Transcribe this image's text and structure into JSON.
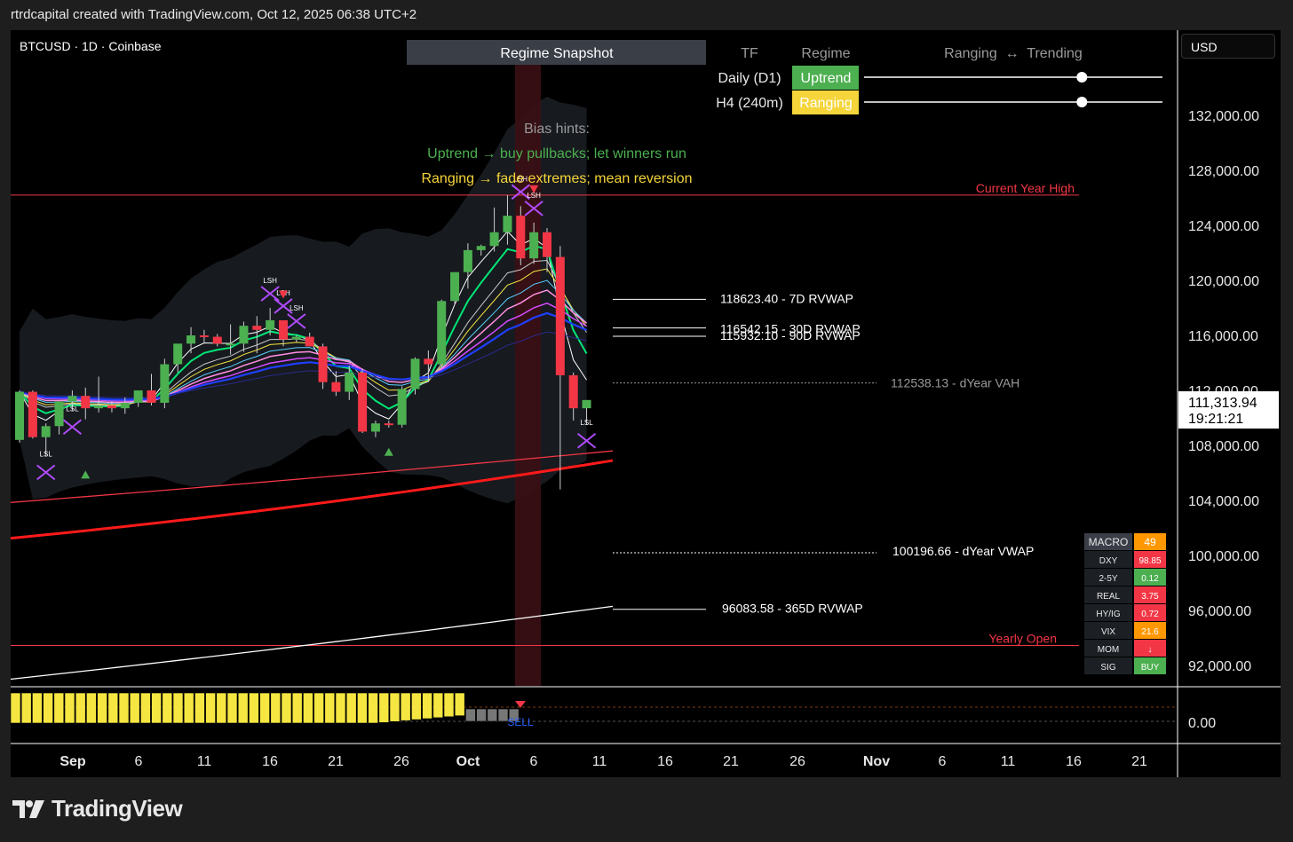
{
  "header": {
    "attribution": "rtrdcapital created with TradingView.com, Oct 12, 2025 06:38 UTC+2"
  },
  "symbol_line": "BTCUSD · 1D · Coinbase",
  "currency_button": "USD",
  "brand": "TradingView",
  "price_axis": {
    "labels": [
      "132,000.00",
      "128,000.00",
      "124,000.00",
      "120,000.00",
      "116,000.00",
      "112,000.00",
      "108,000.00",
      "104,000.00",
      "100,000.00",
      "96,000.00",
      "92,000.00"
    ],
    "values": [
      132000,
      128000,
      124000,
      120000,
      116000,
      112000,
      108000,
      104000,
      100000,
      96000,
      92000
    ],
    "current_price": "111,313.94",
    "countdown": "19:21:21",
    "osc_zero": "0.00"
  },
  "time_axis": {
    "labels": [
      "Sep",
      "6",
      "11",
      "16",
      "21",
      "26",
      "Oct",
      "6",
      "11",
      "16",
      "21",
      "26",
      "Nov",
      "6",
      "11",
      "16",
      "21"
    ],
    "bold": [
      true,
      false,
      false,
      false,
      false,
      false,
      true,
      false,
      false,
      false,
      false,
      false,
      true,
      false,
      false,
      false,
      false
    ]
  },
  "regime": {
    "title": "Regime Snapshot",
    "col_tf": "TF",
    "col_regime": "Regime",
    "col_scale": "Ranging  ↔  Trending",
    "rows": [
      {
        "tf": "Daily (D1)",
        "regime": "Uptrend",
        "color": "#4caf50",
        "position": 0.73
      },
      {
        "tf": "H4 (240m)",
        "regime": "Ranging",
        "color": "#f5d53a",
        "position": 0.73
      }
    ]
  },
  "bias": {
    "title": "Bias hints:",
    "line1": "Uptrend → buy pullbacks; let winners run",
    "line2": "Ranging → fade extremes; mean reversion"
  },
  "levels": [
    {
      "label": "Current Year High",
      "value": 126200,
      "color": "#f23645"
    },
    {
      "label": "118623.40 - 7D RVWAP",
      "value": 118623.4,
      "color": "#ffffff"
    },
    {
      "label": "116542.15 - 30D RVWAP",
      "value": 116542.15,
      "color": "#ffffff"
    },
    {
      "label": "115932.10 - 90D RVWAP",
      "value": 115932.1,
      "color": "#ffffff"
    },
    {
      "label": "112538.13 - dYear VAH",
      "value": 112538.13,
      "color": "#999999"
    },
    {
      "label": "100196.66 - dYear VWAP",
      "value": 100196.66,
      "color": "#ffffff"
    },
    {
      "label": "96083.58 - 365D RVWAP",
      "value": 96083.58,
      "color": "#ffffff"
    },
    {
      "label": "Yearly Open",
      "value": 93450,
      "color": "#f23645"
    }
  ],
  "macro": {
    "rows": [
      {
        "label": "MACRO",
        "value": "49",
        "color": "#ff9800"
      },
      {
        "label": "DXY",
        "value": "98.85",
        "color": "#f23645"
      },
      {
        "label": "2-5Y",
        "value": "0.12",
        "color": "#4caf50"
      },
      {
        "label": "REAL",
        "value": "3.75",
        "color": "#f23645"
      },
      {
        "label": "HY/IG",
        "value": "0.72",
        "color": "#f23645"
      },
      {
        "label": "VIX",
        "value": "21.6",
        "color": "#ff9800"
      },
      {
        "label": "MOM",
        "value": "↓",
        "color": "#f23645"
      },
      {
        "label": "SIG",
        "value": "BUY",
        "color": "#4caf50"
      }
    ]
  },
  "signals": {
    "osc_sell": "SELL",
    "swing_labels": [
      "LSH",
      "LSH",
      "LSH",
      "LSL",
      "LSL",
      "LSH"
    ]
  },
  "colors": {
    "up": "#4caf50",
    "down": "#f23645",
    "yellow": "#f5e642",
    "grey": "#777777",
    "purple": "#b04cff"
  },
  "chart_data": {
    "type": "candlestick",
    "symbol": "BTCUSD",
    "timeframe": "1D",
    "exchange": "Coinbase",
    "ylim": [
      90000,
      134000
    ],
    "dates": [
      "2025-08-30",
      "2025-08-31",
      "2025-09-01",
      "2025-09-02",
      "2025-09-03",
      "2025-09-04",
      "2025-09-05",
      "2025-09-06",
      "2025-09-07",
      "2025-09-08",
      "2025-09-09",
      "2025-09-10",
      "2025-09-11",
      "2025-09-12",
      "2025-09-13",
      "2025-09-14",
      "2025-09-15",
      "2025-09-16",
      "2025-09-17",
      "2025-09-18",
      "2025-09-19",
      "2025-09-20",
      "2025-09-21",
      "2025-09-22",
      "2025-09-23",
      "2025-09-24",
      "2025-09-25",
      "2025-09-26",
      "2025-09-27",
      "2025-09-28",
      "2025-09-29",
      "2025-09-30",
      "2025-10-01",
      "2025-10-02",
      "2025-10-03",
      "2025-10-04",
      "2025-10-05",
      "2025-10-06",
      "2025-10-07",
      "2025-10-08",
      "2025-10-09",
      "2025-10-10",
      "2025-10-11",
      "2025-10-12"
    ],
    "ohlc": [
      [
        108400,
        112000,
        108200,
        111900
      ],
      [
        111900,
        112000,
        108500,
        108600
      ],
      [
        108600,
        109600,
        107200,
        109400
      ],
      [
        109400,
        111200,
        108800,
        111200
      ],
      [
        111200,
        112000,
        110500,
        111600
      ],
      [
        111600,
        112200,
        109900,
        110700
      ],
      [
        110700,
        113000,
        110400,
        110900
      ],
      [
        110900,
        111200,
        110400,
        110700
      ],
      [
        110700,
        111500,
        110300,
        111100
      ],
      [
        111100,
        112000,
        110800,
        112000
      ],
      [
        112000,
        113200,
        110900,
        111100
      ],
      [
        111100,
        114300,
        110700,
        113900
      ],
      [
        113900,
        115200,
        113300,
        115400
      ],
      [
        115400,
        116600,
        114700,
        116000
      ],
      [
        116000,
        116400,
        115500,
        115900
      ],
      [
        115900,
        116100,
        115200,
        115400
      ],
      [
        115400,
        116800,
        114600,
        115400
      ],
      [
        115400,
        117000,
        114800,
        116700
      ],
      [
        116700,
        117400,
        114700,
        116400
      ],
      [
        116400,
        118000,
        116000,
        117100
      ],
      [
        117100,
        117100,
        115200,
        115700
      ],
      [
        115700,
        116000,
        115500,
        115900
      ],
      [
        115900,
        116200,
        115200,
        115200
      ],
      [
        115200,
        115400,
        112100,
        112600
      ],
      [
        112600,
        113400,
        111600,
        111900
      ],
      [
        111900,
        113800,
        111300,
        113300
      ],
      [
        113300,
        113600,
        108900,
        109000
      ],
      [
        109000,
        109800,
        108600,
        109600
      ],
      [
        109600,
        109800,
        109300,
        109500
      ],
      [
        109500,
        112300,
        109300,
        112100
      ],
      [
        112100,
        114400,
        111700,
        114300
      ],
      [
        114300,
        114900,
        112700,
        113900
      ],
      [
        113900,
        118600,
        113700,
        118500
      ],
      [
        118500,
        120500,
        118200,
        120600
      ],
      [
        120600,
        122700,
        119400,
        122200
      ],
      [
        122200,
        122600,
        121800,
        122500
      ],
      [
        122500,
        125300,
        122100,
        123500
      ],
      [
        123500,
        126200,
        122600,
        124700
      ],
      [
        124700,
        125400,
        121100,
        121600
      ],
      [
        121600,
        124200,
        121200,
        123500
      ],
      [
        123500,
        123800,
        120600,
        121700
      ],
      [
        121700,
        122500,
        104800,
        113100
      ],
      [
        113100,
        113300,
        109800,
        110700
      ],
      [
        110700,
        111300,
        109500,
        111300
      ]
    ],
    "overlays": [
      "EMA ribbon",
      "Bollinger/Keltner envelope",
      "RVWAP levels",
      "200D SMA (red)",
      "365D RVWAP (white)"
    ]
  }
}
